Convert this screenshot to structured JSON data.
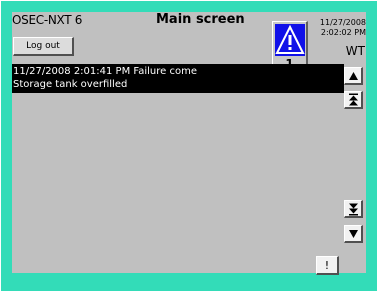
{
  "header": {
    "product": "OSEC-NXT 6",
    "title": "Main screen",
    "logout_label": "Log out",
    "date": "11/27/2008",
    "time": "2:02:02 PM",
    "user": "WT"
  },
  "alarm": {
    "icon": "warning-triangle-icon",
    "count": "1",
    "icon_color": "#1010e8"
  },
  "messages": [
    "11/27/2008 2:01:41 PM Failure  come",
    "Storage tank overfilled"
  ],
  "nav": {
    "up": "arrow-up-icon",
    "page_up": "double-arrow-up-icon",
    "page_down": "double-arrow-down-icon",
    "down": "arrow-down-icon"
  },
  "ack_label": "!",
  "colors": {
    "frame": "#33dcb8",
    "screen": "#c0c0c0"
  }
}
